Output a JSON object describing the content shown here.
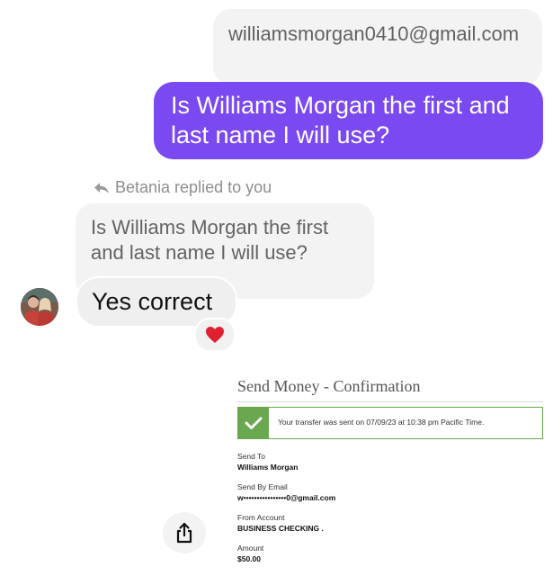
{
  "messages": {
    "quoted_own": "williamsmorgan0410@gmail.com",
    "sent": "Is Williams Morgan the first and last name I will use?",
    "reply_label": "Betania replied to you",
    "quoted_received": "Is Williams Morgan the first and last name I will use?",
    "received": "Yes correct",
    "reaction": "❤️"
  },
  "icons": {
    "reply": "reply-arrow-icon",
    "share": "share-icon",
    "check": "check-icon",
    "avatar": "avatar"
  },
  "colors": {
    "sent_bubble": "#7b49f2",
    "received_bubble": "#efefef",
    "notice_green": "#6aa84f"
  },
  "attachment": {
    "title": "Send Money - Confirmation",
    "notice": "Your transfer was sent on 07/09/23 at 10:38 pm Pacific Time.",
    "fields": [
      {
        "label": "Send To",
        "value": "Williams Morgan"
      },
      {
        "label": "Send By Email",
        "value": "w••••••••••••••••0@gmail.com"
      },
      {
        "label": "From Account",
        "value": "BUSINESS CHECKING ."
      },
      {
        "label": "Amount",
        "value": "$50.00"
      }
    ]
  }
}
